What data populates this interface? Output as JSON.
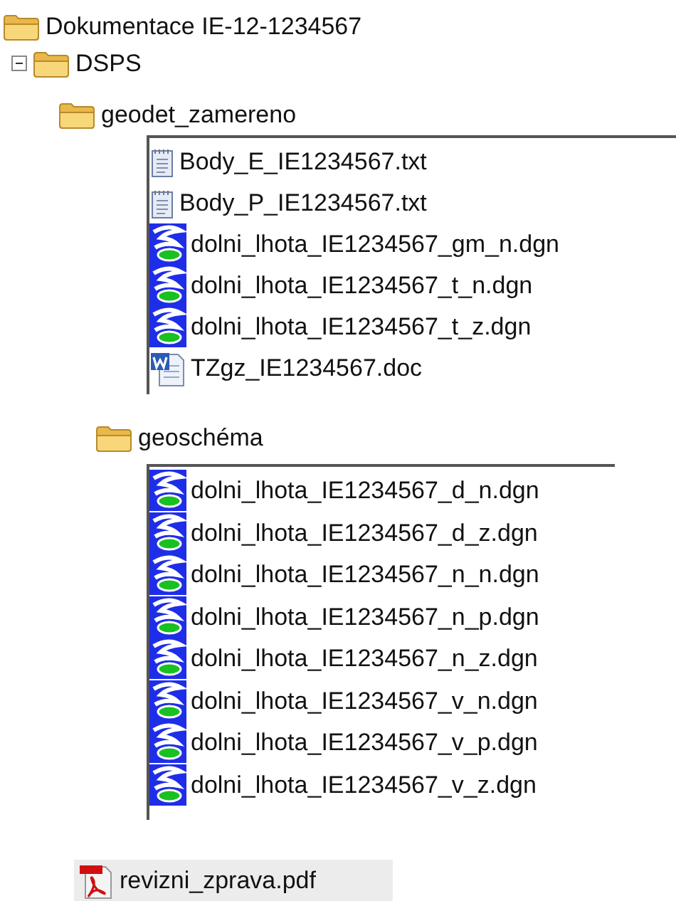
{
  "tree": {
    "name": "Dokumentace IE-12-1234567",
    "children": [
      {
        "name": "DSPS",
        "expanded": true,
        "children": [
          {
            "name": "geodet_zamereno",
            "files": [
              {
                "name": "Body_E_IE1234567.txt",
                "kind": "text"
              },
              {
                "name": "Body_P_IE1234567.txt",
                "kind": "text"
              },
              {
                "name": "dolni_lhota_IE1234567_gm_n.dgn",
                "kind": "dgn"
              },
              {
                "name": "dolni_lhota_IE1234567_t_n.dgn",
                "kind": "dgn"
              },
              {
                "name": "dolni_lhota_IE1234567_t_z.dgn",
                "kind": "dgn"
              },
              {
                "name": "TZgz_IE1234567.doc",
                "kind": "doc"
              }
            ]
          },
          {
            "name": "geoschéma",
            "files": [
              {
                "name": "dolni_lhota_IE1234567_d_n.dgn",
                "kind": "dgn"
              },
              {
                "name": "dolni_lhota_IE1234567_d_z.dgn",
                "kind": "dgn"
              },
              {
                "name": "dolni_lhota_IE1234567_n_n.dgn",
                "kind": "dgn"
              },
              {
                "name": "dolni_lhota_IE1234567_n_p.dgn",
                "kind": "dgn"
              },
              {
                "name": "dolni_lhota_IE1234567_n_z.dgn",
                "kind": "dgn"
              },
              {
                "name": "dolni_lhota_IE1234567_v_n.dgn",
                "kind": "dgn"
              },
              {
                "name": "dolni_lhota_IE1234567_v_p.dgn",
                "kind": "dgn"
              },
              {
                "name": "dolni_lhota_IE1234567_v_z.dgn",
                "kind": "dgn"
              }
            ]
          }
        ]
      }
    ]
  },
  "loose_files": [
    {
      "name": "revizni_zprava.pdf",
      "kind": "pdf",
      "selected": true
    }
  ]
}
